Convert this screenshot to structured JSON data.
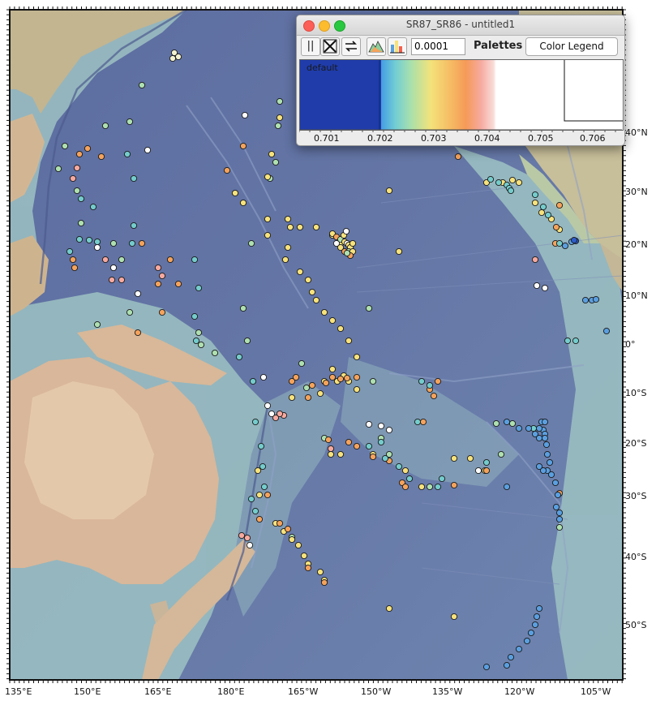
{
  "map": {
    "longitude_labels": [
      "135°E",
      "150°E",
      "165°E",
      "180°E",
      "165°W",
      "150°W",
      "135°W",
      "120°W",
      "105°W"
    ],
    "latitude_labels": [
      "40°N",
      "30°N",
      "20°N",
      "10°N",
      "0°",
      "10°S",
      "20°S",
      "30°S",
      "40°S",
      "50°S"
    ],
    "colors": {
      "ocean_deep": "#5c6ca0",
      "ocean_shelf": "#9fc6c4",
      "land_low": "#d9b89a",
      "land_high": "#b7c7a9",
      "frame": "#111111"
    }
  },
  "palette_window": {
    "title": "SR87_SR86 - untitled1",
    "range_value": "0.0001",
    "palettes_label": "Palettes",
    "color_legend_label": "Color Legend",
    "palette_name": "default",
    "axis_ticks": [
      "0.701",
      "0.702",
      "0.703",
      "0.704",
      "0.705",
      "0.706"
    ],
    "icons": [
      "pause-icon",
      "cross-icon",
      "swap-icon",
      "histogram-icon",
      "bar-chart-icon"
    ]
  },
  "samples": [
    [
      "#f1f1d0",
      [
        [
          215,
          65
        ],
        [
          213,
          72
        ],
        [
          220,
          70
        ]
      ]
    ],
    [
      "#aee0b0",
      [
        [
          175,
          105
        ],
        [
          160,
          150
        ],
        [
          130,
          155
        ],
        [
          80,
          180
        ],
        [
          72,
          208
        ],
        [
          95,
          235
        ],
        [
          100,
          275
        ],
        [
          140,
          300
        ],
        [
          150,
          320
        ],
        [
          160,
          385
        ],
        [
          120,
          400
        ],
        [
          345,
          125
        ],
        [
          343,
          155
        ],
        [
          340,
          200
        ],
        [
          333,
          220
        ],
        [
          310,
          300
        ],
        [
          300,
          380
        ],
        [
          305,
          420
        ],
        [
          265,
          435
        ],
        [
          248,
          425
        ],
        [
          245,
          410
        ],
        [
          455,
          380
        ],
        [
          460,
          470
        ],
        [
          470,
          540
        ],
        [
          480,
          560
        ],
        [
          612,
          522
        ],
        [
          632,
          522
        ],
        [
          618,
          560
        ],
        [
          530,
          600
        ],
        [
          400,
          540
        ],
        [
          372,
          448
        ],
        [
          378,
          478
        ],
        [
          690,
          650
        ],
        [
          360,
          662
        ]
      ]
    ],
    [
      "#f7e27c",
      [
        [
          345,
          145
        ],
        [
          335,
          190
        ],
        [
          330,
          218
        ],
        [
          290,
          238
        ],
        [
          300,
          250
        ],
        [
          330,
          270
        ],
        [
          330,
          290
        ],
        [
          355,
          270
        ],
        [
          358,
          280
        ],
        [
          370,
          280
        ],
        [
          390,
          280
        ],
        [
          410,
          290
        ],
        [
          420,
          300
        ],
        [
          430,
          310
        ],
        [
          355,
          305
        ],
        [
          352,
          320
        ],
        [
          370,
          335
        ],
        [
          380,
          345
        ],
        [
          385,
          360
        ],
        [
          390,
          370
        ],
        [
          400,
          385
        ],
        [
          410,
          395
        ],
        [
          420,
          405
        ],
        [
          430,
          420
        ],
        [
          440,
          440
        ],
        [
          480,
          235
        ],
        [
          492,
          310
        ],
        [
          440,
          480
        ],
        [
          430,
          470
        ],
        [
          408,
          560
        ],
        [
          420,
          560
        ],
        [
          460,
          560
        ],
        [
          500,
          580
        ],
        [
          520,
          600
        ],
        [
          560,
          565
        ],
        [
          580,
          565
        ],
        [
          598,
          580
        ],
        [
          560,
          760
        ],
        [
          480,
          750
        ],
        [
          400,
          715
        ],
        [
          395,
          705
        ],
        [
          380,
          695
        ],
        [
          375,
          685
        ],
        [
          368,
          672
        ],
        [
          360,
          665
        ],
        [
          350,
          655
        ],
        [
          340,
          645
        ],
        [
          320,
          610
        ],
        [
          318,
          580
        ],
        [
          360,
          490
        ],
        [
          400,
          470
        ],
        [
          410,
          455
        ],
        [
          424,
          463
        ],
        [
          416,
          470
        ],
        [
          395,
          485
        ],
        [
          620,
          225
        ],
        [
          632,
          222
        ],
        [
          600,
          225
        ],
        [
          640,
          225
        ],
        [
          660,
          250
        ],
        [
          668,
          262
        ],
        [
          680,
          270
        ],
        [
          690,
          283
        ]
      ]
    ],
    [
      "#f5a35c",
      [
        [
          108,
          183
        ],
        [
          125,
          193
        ],
        [
          98,
          190
        ],
        [
          220,
          350
        ],
        [
          195,
          350
        ],
        [
          210,
          320
        ],
        [
          175,
          300
        ],
        [
          280,
          210
        ],
        [
          300,
          180
        ],
        [
          385,
          475
        ],
        [
          402,
          472
        ],
        [
          410,
          465
        ],
        [
          420,
          467
        ],
        [
          428,
          466
        ],
        [
          440,
          465
        ],
        [
          405,
          542
        ],
        [
          430,
          545
        ],
        [
          440,
          550
        ],
        [
          460,
          563
        ],
        [
          480,
          568
        ],
        [
          496,
          595
        ],
        [
          500,
          600
        ],
        [
          560,
          598
        ],
        [
          600,
          580
        ],
        [
          522,
          520
        ],
        [
          535,
          488
        ],
        [
          530,
          480
        ],
        [
          540,
          470
        ],
        [
          690,
          608
        ],
        [
          355,
          652
        ],
        [
          345,
          645
        ],
        [
          330,
          610
        ],
        [
          320,
          640
        ],
        [
          380,
          700
        ],
        [
          400,
          718
        ],
        [
          565,
          193
        ],
        [
          690,
          253
        ],
        [
          686,
          280
        ],
        [
          685,
          300
        ],
        [
          170,
          410
        ],
        [
          90,
          320
        ],
        [
          92,
          330
        ],
        [
          200,
          385
        ],
        [
          360,
          470
        ],
        [
          365,
          465
        ],
        [
          380,
          490
        ]
      ]
    ],
    [
      "#f7a99f",
      [
        [
          95,
          207
        ],
        [
          90,
          220
        ],
        [
          130,
          320
        ],
        [
          140,
          330
        ],
        [
          138,
          345
        ],
        [
          150,
          345
        ],
        [
          200,
          340
        ],
        [
          195,
          330
        ],
        [
          408,
          553
        ],
        [
          350,
          512
        ],
        [
          345,
          510
        ],
        [
          340,
          515
        ],
        [
          298,
          660
        ],
        [
          305,
          663
        ],
        [
          660,
          320
        ]
      ]
    ],
    [
      "#ffffff",
      [
        [
          302,
          142
        ],
        [
          182,
          185
        ],
        [
          140,
          330
        ],
        [
          120,
          305
        ],
        [
          170,
          362
        ],
        [
          325,
          465
        ],
        [
          330,
          500
        ],
        [
          335,
          510
        ],
        [
          455,
          523
        ],
        [
          470,
          525
        ],
        [
          480,
          530
        ],
        [
          590,
          580
        ],
        [
          662,
          352
        ],
        [
          672,
          355
        ],
        [
          308,
          672
        ]
      ]
    ],
    [
      "#74cccc",
      [
        [
          157,
          190
        ],
        [
          165,
          220
        ],
        [
          100,
          245
        ],
        [
          115,
          255
        ],
        [
          165,
          278
        ],
        [
          163,
          300
        ],
        [
          98,
          295
        ],
        [
          86,
          310
        ],
        [
          110,
          296
        ],
        [
          120,
          298
        ],
        [
          240,
          320
        ],
        [
          245,
          355
        ],
        [
          240,
          390
        ],
        [
          242,
          420
        ],
        [
          295,
          440
        ],
        [
          312,
          470
        ],
        [
          315,
          520
        ],
        [
          322,
          550
        ],
        [
          324,
          575
        ],
        [
          326,
          600
        ],
        [
          310,
          615
        ],
        [
          315,
          630
        ],
        [
          455,
          550
        ],
        [
          470,
          545
        ],
        [
          475,
          565
        ],
        [
          492,
          575
        ],
        [
          505,
          590
        ],
        [
          545,
          590
        ],
        [
          540,
          600
        ],
        [
          600,
          570
        ],
        [
          515,
          520
        ],
        [
          520,
          470
        ],
        [
          530,
          475
        ],
        [
          660,
          240
        ],
        [
          670,
          255
        ],
        [
          676,
          265
        ],
        [
          690,
          300
        ],
        [
          700,
          420
        ],
        [
          710,
          420
        ],
        [
          605,
          221
        ],
        [
          615,
          225
        ],
        [
          625,
          228
        ],
        [
          628,
          232
        ],
        [
          630,
          235
        ],
        [
          658,
          528
        ]
      ]
    ],
    [
      "#5a9fe0",
      [
        [
          697,
          303
        ],
        [
          705,
          298
        ],
        [
          722,
          370
        ],
        [
          730,
          370
        ],
        [
          735,
          369
        ],
        [
          748,
          408
        ],
        [
          625,
          520
        ],
        [
          640,
          528
        ],
        [
          652,
          528
        ],
        [
          660,
          535
        ],
        [
          665,
          540
        ],
        [
          670,
          530
        ],
        [
          672,
          535
        ],
        [
          675,
          560
        ],
        [
          678,
          570
        ],
        [
          675,
          580
        ],
        [
          670,
          580
        ],
        [
          665,
          575
        ],
        [
          680,
          585
        ],
        [
          685,
          595
        ],
        [
          688,
          610
        ],
        [
          686,
          625
        ],
        [
          690,
          632
        ],
        [
          690,
          640
        ],
        [
          672,
          540
        ],
        [
          674,
          548
        ],
        [
          640,
          800
        ],
        [
          650,
          790
        ],
        [
          655,
          780
        ],
        [
          660,
          770
        ],
        [
          662,
          760
        ],
        [
          665,
          750
        ],
        [
          630,
          810
        ],
        [
          625,
          820
        ],
        [
          600,
          822
        ],
        [
          625,
          600
        ],
        [
          668,
          520
        ],
        [
          672,
          520
        ],
        [
          665,
          528
        ]
      ]
    ],
    [
      "#2e5cc8",
      [
        [
          710,
          297
        ],
        [
          708,
          296
        ]
      ]
    ]
  ],
  "cluster_hawaii": [
    [
      410,
      288
    ],
    [
      415,
      292
    ],
    [
      420,
      295
    ],
    [
      425,
      298
    ],
    [
      428,
      300
    ],
    [
      430,
      302
    ],
    [
      432,
      305
    ],
    [
      425,
      310
    ],
    [
      430,
      310
    ],
    [
      420,
      305
    ],
    [
      415,
      300
    ],
    [
      435,
      300
    ],
    [
      435,
      310
    ],
    [
      432,
      315
    ],
    [
      428,
      312
    ],
    [
      424,
      290
    ],
    [
      427,
      285
    ]
  ]
}
